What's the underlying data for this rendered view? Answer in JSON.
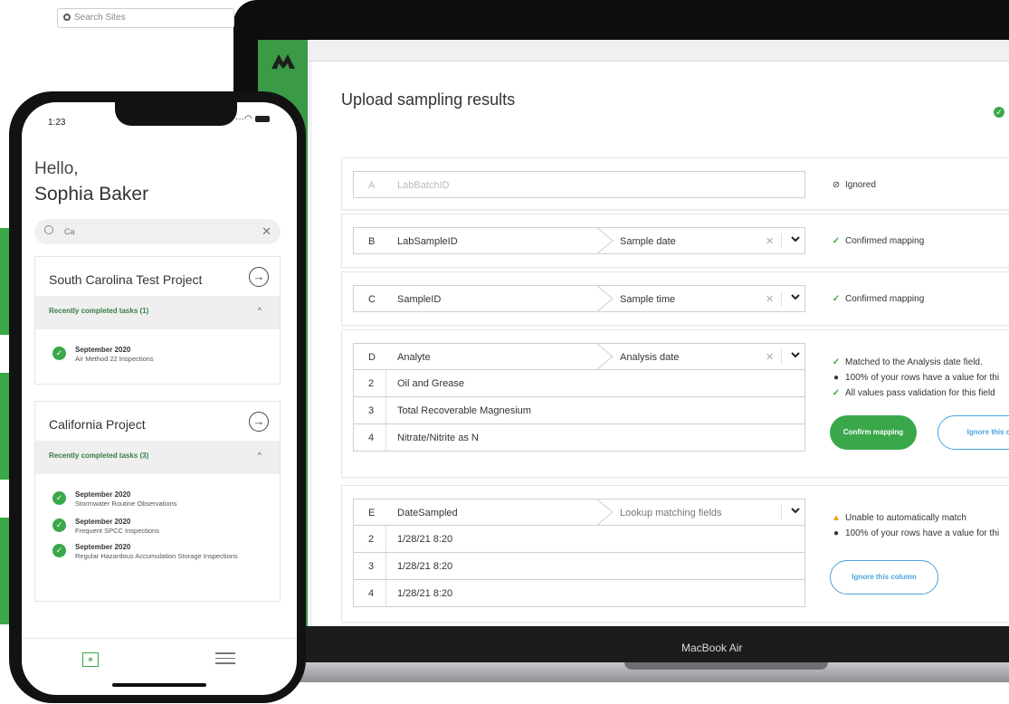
{
  "laptop": {
    "search_placeholder": "Search Sites",
    "brand": "MacBook Air"
  },
  "modal": {
    "title": "Upload sampling results",
    "rows": [
      {
        "letter": "A",
        "name": "LabBatchID",
        "status": "Ignored"
      },
      {
        "letter": "B",
        "name": "LabSampleID",
        "field": "Sample date",
        "status": "Confirmed mapping"
      },
      {
        "letter": "C",
        "name": "SampleID",
        "field": "Sample time",
        "status": "Confirmed mapping"
      },
      {
        "letter": "D",
        "name": "Analyte",
        "field": "Analysis date",
        "values": [
          {
            "n": "2",
            "v": "Oil and Grease"
          },
          {
            "n": "3",
            "v": "Total Recoverable Magnesium"
          },
          {
            "n": "4",
            "v": "Nitrate/Nitrite as N"
          }
        ],
        "msgs": [
          "Matched to the  Analysis date  field.",
          "100% of your rows have a value for thi",
          "All values pass validation for this field"
        ],
        "confirm_label": "Confirm mapping",
        "ignore_label": "Ignore this col"
      },
      {
        "letter": "E",
        "name": "DateSampled",
        "field": "Lookup matching fields",
        "values": [
          {
            "n": "2",
            "v": "1/28/21 8:20"
          },
          {
            "n": "3",
            "v": "1/28/21 8:20"
          },
          {
            "n": "4",
            "v": "1/28/21 8:20"
          }
        ],
        "msgs": [
          "Unable to automatically match",
          "100% of your rows have a value for thi"
        ],
        "ignore_label": "Ignore this column"
      }
    ]
  },
  "phone": {
    "time": "1:23",
    "greeting": "Hello,",
    "user_name": "Sophia Baker",
    "search_value": "Ca",
    "projects": [
      {
        "title": "South Carolina Test Project",
        "recent": "Recently completed tasks (1)",
        "tasks": [
          {
            "date": "September 2020",
            "name": "Air Method 22 Inspections"
          }
        ]
      },
      {
        "title": "California Project",
        "recent": "Recently completed tasks (3)",
        "tasks": [
          {
            "date": "September 2020",
            "name": "Stormwater Routine Observations"
          },
          {
            "date": "September 2020",
            "name": "Frequent SPCC Inspections"
          },
          {
            "date": "September 2020",
            "name": "Regular Hazardous Accumulation Storage Inspections"
          }
        ]
      }
    ]
  }
}
